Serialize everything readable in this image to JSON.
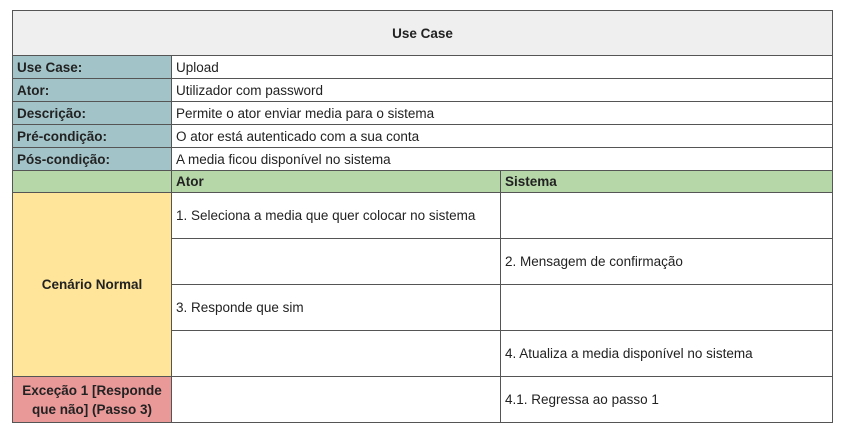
{
  "title": "Use Case",
  "fields": [
    {
      "label": "Use Case:",
      "value": "Upload"
    },
    {
      "label": "Ator:",
      "value": "Utilizador com password"
    },
    {
      "label": "Descrição:",
      "value": "Permite o ator enviar media para o sistema"
    },
    {
      "label": "Pré-condição:",
      "value": "O ator está autenticado com a sua conta"
    },
    {
      "label": "Pós-condição:",
      "value": "A media ficou disponível no sistema"
    }
  ],
  "headers": {
    "blank": "",
    "actor": "Ator",
    "system": "Sistema"
  },
  "normal_scenario": {
    "label": "Cenário Normal",
    "steps": [
      {
        "actor": "1. Seleciona a media que quer colocar no sistema",
        "system": ""
      },
      {
        "actor": "",
        "system": "2. Mensagem de confirmação"
      },
      {
        "actor": "3. Responde que sim",
        "system": ""
      },
      {
        "actor": "",
        "system": "4. Atualiza a media disponível no sistema"
      }
    ]
  },
  "exception": {
    "label": "Exceção 1 [Responde que não] (Passo 3)",
    "actor": "",
    "system": "4.1. Regressa ao passo 1"
  },
  "colors": {
    "title_bg": "#efefef",
    "label_bg": "#a2c4c9",
    "header_bg": "#b6d7a8",
    "normal_bg": "#ffe599",
    "exception_bg": "#ea9999"
  }
}
